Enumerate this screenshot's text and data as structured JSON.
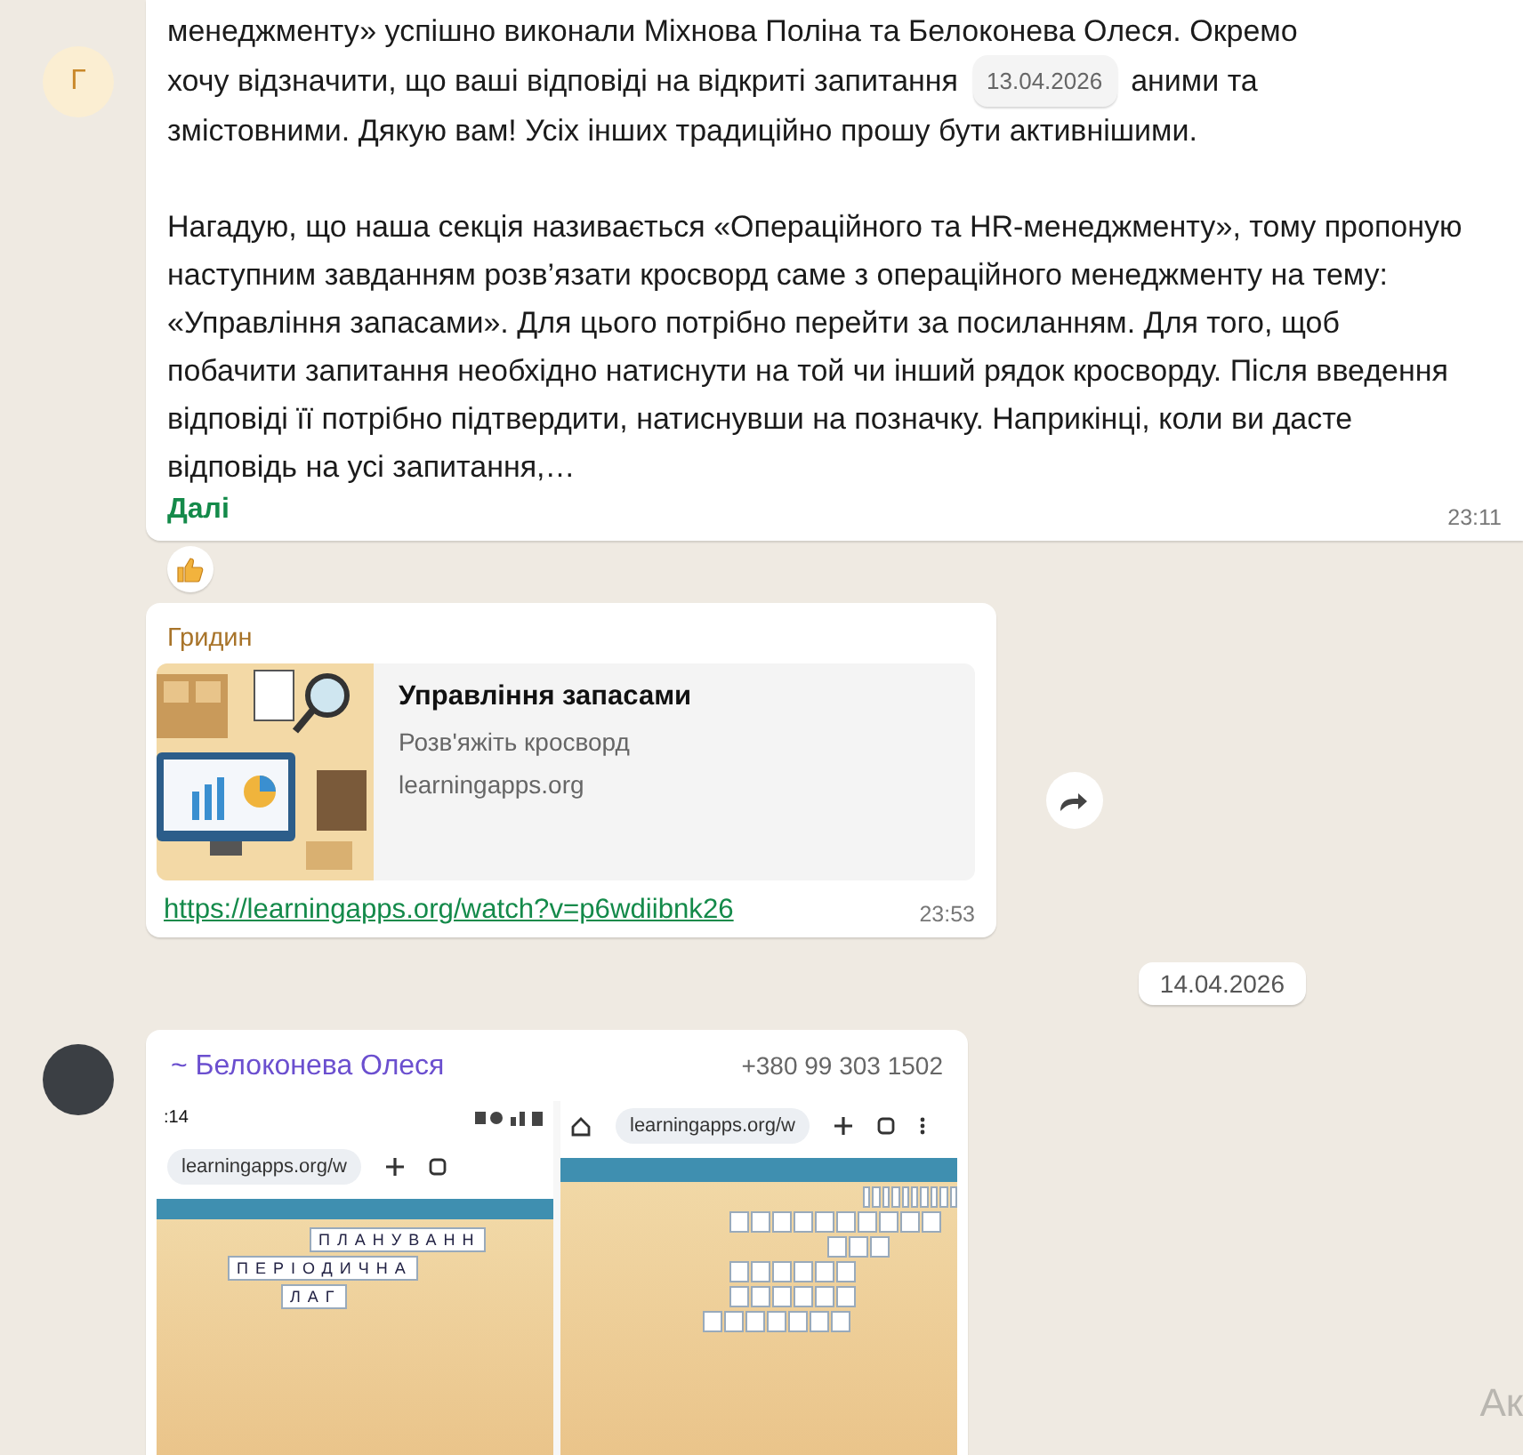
{
  "messages": [
    {
      "kind": "text",
      "avatar": "Г",
      "first_line": "менеджменту» успішно виконали Міхнова Поліна та Белоконева Олеся. Окремо",
      "text_before": "хочу відзначити, що ваші відповіді на відкриті запитання",
      "date_overlay": "13.04.2026",
      "text_after": "аними та",
      "last_line": "змістовними. Дякую вам! Усіх інших традиційно прошу бути активнішими.",
      "paragraph": "Нагадую, що наша секція називається «Операційного та HR-менеджменту», тому пропоную наступним завданням розв’язати кросворд саме з операційного менеджменту на тему: «Управління запасами». Для цього потрібно перейти за посиланням. Для того, щоб побачити запитання необхідно натиснути на той чи інший рядок кросворду. Після введення відповіді її потрібно підтвердити, натиснувши на позначку. Наприкінці, коли ви дасте відповідь на усі запитання,…",
      "more_link": "Далі",
      "time": "23:11",
      "reacted": true
    },
    {
      "kind": "link",
      "sender": "Гридин",
      "preview": {
        "title": "Управління запасами",
        "description": "Розв'яжіть кросворд",
        "domain": "learningapps.org"
      },
      "url": "https://learningapps.org/watch?v=p6wdiibnk26",
      "time": "23:53"
    },
    {
      "kind": "date",
      "label": "14.04.2026"
    },
    {
      "kind": "image",
      "sender": "~ Белоконева Олеся",
      "phone": "+380 99 303 1502",
      "screenshots": [
        {
          "status_time": ":14",
          "url": "learningapps.org/w",
          "rows": [
            "ПЛАНУВАНН",
            "ПЕРІОДИЧНА",
            "ЛАГ"
          ]
        },
        {
          "url": "learningapps.org/w"
        }
      ]
    }
  ],
  "corner_text": "Ак"
}
